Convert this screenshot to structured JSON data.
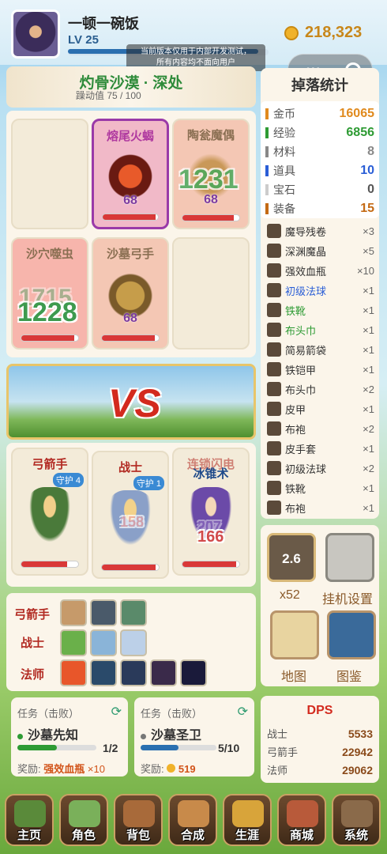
{
  "player": {
    "name": "一顿一碗饭",
    "level": "LV 25",
    "gold": "218,323",
    "level_progress": 0.95
  },
  "notice": {
    "line1": "当前版本仅用于内部开发测试，",
    "line2": "所有内容均不面向用户"
  },
  "area": {
    "title": "灼骨沙漠 · 深处",
    "heat": "躁动值 75 / 100"
  },
  "enemies": [
    {
      "name": "熔尾火蝎",
      "level": "68",
      "hp": 0.95
    },
    {
      "name": "陶瓮魔偶",
      "level": "68",
      "hp": 0.9,
      "damage": "1231"
    },
    {
      "name": "沙穴噬虫",
      "damage": "1715",
      "damage2": "1228",
      "hp": 0.93
    },
    {
      "name": "沙墓弓手",
      "level": "68",
      "hp": 0.93
    }
  ],
  "vs": "VS",
  "heroes": [
    {
      "name": "弓箭手",
      "guard": "守护 4",
      "hp": 0.8
    },
    {
      "name": "战士",
      "guard": "守护 1",
      "damage": "158",
      "hp": 0.95
    },
    {
      "name": "连锁闪电",
      "skill": "冰锥术",
      "damage": "166",
      "damage_faint": "207",
      "hp": 0.95
    }
  ],
  "skills": {
    "archer": "弓箭手",
    "warrior": "战士",
    "mage": "法师"
  },
  "drops": {
    "title": "掉落统计",
    "stats": [
      {
        "label": "金币",
        "value": "16065",
        "color": "#e08a1e"
      },
      {
        "label": "经验",
        "value": "6856",
        "color": "#2e9b34"
      },
      {
        "label": "材料",
        "value": "8",
        "color": "#888888"
      },
      {
        "label": "道具",
        "value": "10",
        "color": "#2a5ed6"
      },
      {
        "label": "宝石",
        "value": "0",
        "color": "#cccccc"
      },
      {
        "label": "装备",
        "value": "15",
        "color": "#c46a14"
      }
    ],
    "items": [
      {
        "name": "魔导残卷",
        "qty": "×3",
        "color": "#333"
      },
      {
        "name": "深渊魔晶",
        "qty": "×5",
        "color": "#333"
      },
      {
        "name": "强效血瓶",
        "qty": "×10",
        "color": "#333"
      },
      {
        "name": "初级法球",
        "qty": "×1",
        "color": "#2a5ed6"
      },
      {
        "name": "铁靴",
        "qty": "×1",
        "color": "#2e9b34"
      },
      {
        "name": "布头巾",
        "qty": "×1",
        "color": "#2e9b34"
      },
      {
        "name": "简易箭袋",
        "qty": "×1",
        "color": "#333"
      },
      {
        "name": "铁铠甲",
        "qty": "×1",
        "color": "#333"
      },
      {
        "name": "布头巾",
        "qty": "×2",
        "color": "#333"
      },
      {
        "name": "皮甲",
        "qty": "×1",
        "color": "#333"
      },
      {
        "name": "布袍",
        "qty": "×2",
        "color": "#333"
      },
      {
        "name": "皮手套",
        "qty": "×1",
        "color": "#333"
      },
      {
        "name": "初级法球",
        "qty": "×2",
        "color": "#333"
      },
      {
        "name": "铁靴",
        "qty": "×1",
        "color": "#333"
      },
      {
        "name": "布袍",
        "qty": "×1",
        "color": "#333"
      }
    ]
  },
  "controls": {
    "speed": "2.6",
    "multiplier": "x52",
    "settings": "挂机设置",
    "map": "地图",
    "codex": "图鉴"
  },
  "tasks": [
    {
      "header": "任务（击败）",
      "target": "沙墓先知",
      "progress": "1/2",
      "progress_value": 0.5,
      "reward_label": "奖励:",
      "reward": "强效血瓶",
      "reward_qty": "×10"
    },
    {
      "header": "任务（击败）",
      "target": "沙墓圣卫",
      "progress": "5/10",
      "progress_value": 0.5,
      "reward_label": "奖励:",
      "reward": "519"
    }
  ],
  "dps": {
    "title": "DPS",
    "rows": [
      {
        "label": "战士",
        "value": "5533"
      },
      {
        "label": "弓箭手",
        "value": "22942"
      },
      {
        "label": "法师",
        "value": "29062"
      }
    ]
  },
  "nav": [
    "主页",
    "角色",
    "背包",
    "合成",
    "生涯",
    "商城",
    "系统"
  ],
  "colors": {
    "accent": "#2a6fb0",
    "damage_red": "#d93838",
    "gold": "#c8871a"
  }
}
